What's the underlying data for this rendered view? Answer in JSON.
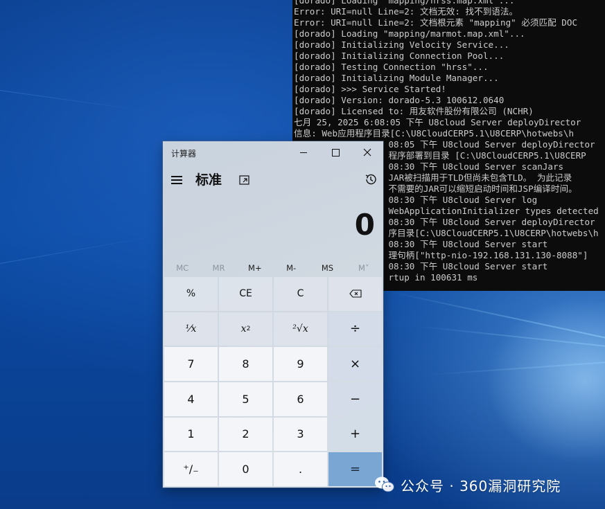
{
  "console": {
    "lines": [
      "[dorado] Loading \"mapping/hrss.map.xml\"...",
      "Error: URI=null Line=2: 文档无效: 找不到语法。",
      "Error: URI=null Line=2: 文档根元素 \"mapping\" 必须匹配 DOC",
      "[dorado] Loading \"mapping/marmot.map.xml\"...",
      "[dorado] Initializing Velocity Service...",
      "[dorado] Initializing Connection Pool...",
      "[dorado] Testing Connection \"hrss\"...",
      "[dorado] Initializing Module Manager...",
      "[dorado] >>> Service Started!",
      "[dorado] Version: dorado-5.3 100612.0640",
      "[dorado] Licensed to: 用友软件股份有限公司 (NCHR)",
      "七月 25, 2025 6:08:05 下午 U8cloud Server deployDirector",
      "信息: Web应用程序目录[C:\\U8CloudCERP5.1\\U8CERP\\hotwebs\\h",
      "                  08:05 下午 U8cloud Server deployDirector",
      "                  程序部署到目录 [C:\\U8CloudCERP5.1\\U8CERP",
      "                  08:30 下午 U8cloud Server scanJars",
      "                  JAR被扫描用于TLD但尚未包含TLD。 为此记录",
      "                  不需要的JAR可以缩短启动时间和JSP编译时间。",
      "                  08:30 下午 U8cloud Server log",
      "                  WebApplicationInitializer types detected",
      "                  08:30 下午 U8cloud Server deployDirector",
      "                  序目录[C:\\U8CloudCERP5.1\\U8CERP\\hotwebs\\h",
      "                  08:30 下午 U8cloud Server start",
      "                  理句柄[\"http-nio-192.168.131.130-8088\"]",
      "                  08:30 下午 U8cloud Server start",
      "                  rtup in 100631 ms"
    ]
  },
  "calculator": {
    "window_title": "计算器",
    "mode_title": "标准",
    "display_value": "0",
    "memory": [
      {
        "label": "MC",
        "enabled": false
      },
      {
        "label": "MR",
        "enabled": false
      },
      {
        "label": "M+",
        "enabled": true
      },
      {
        "label": "M-",
        "enabled": true
      },
      {
        "label": "MS",
        "enabled": true
      },
      {
        "label": "M˅",
        "enabled": false
      }
    ],
    "keys": {
      "percent": "%",
      "ce": "CE",
      "c": "C",
      "backspace": "⌫",
      "reciprocal": "⅟x",
      "square_base": "x",
      "square_exp": "2",
      "sqrt": "²√x",
      "divide": "÷",
      "seven": "7",
      "eight": "8",
      "nine": "9",
      "multiply": "×",
      "four": "4",
      "five": "5",
      "six": "6",
      "minus": "−",
      "one": "1",
      "two": "2",
      "three": "3",
      "plus": "+",
      "negate": "⁺∕₋",
      "zero": "0",
      "decimal": ".",
      "equals": "="
    },
    "icons": {
      "menu": "hamburger-menu-icon",
      "keep_on_top": "keep-on-top-icon",
      "history": "history-icon",
      "minimize": "minimize-icon",
      "maximize": "maximize-icon",
      "close": "close-icon"
    },
    "colors": {
      "equals_bg": "#7aa6d4"
    }
  },
  "watermark": {
    "text": "公众号 · 360漏洞研究院"
  }
}
